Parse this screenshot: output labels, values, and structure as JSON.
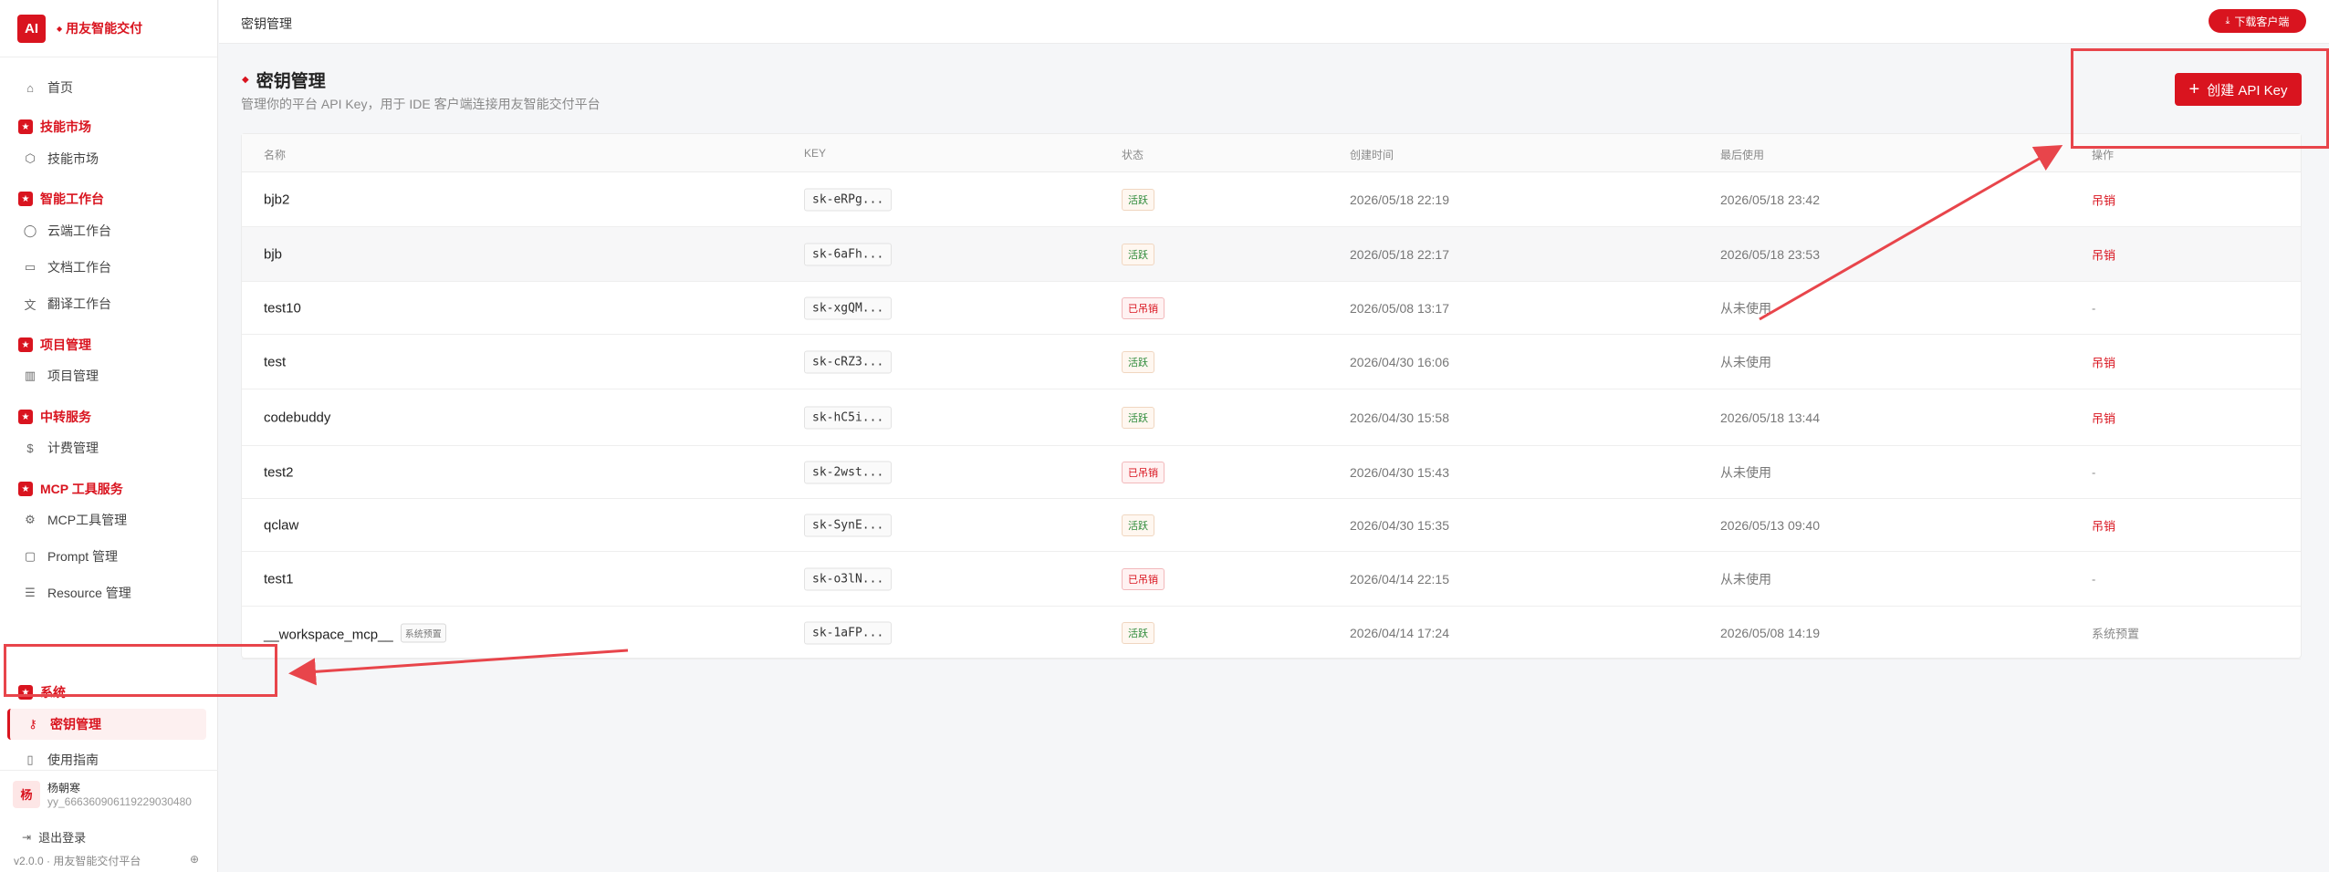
{
  "brand": {
    "logo_text": "AI",
    "name": "用友智能交付"
  },
  "sidebar": {
    "home": "首页",
    "sections": [
      {
        "title": "技能市场",
        "items": [
          "技能市场"
        ]
      },
      {
        "title": "智能工作台",
        "items": [
          "云端工作台",
          "文档工作台",
          "翻译工作台"
        ]
      },
      {
        "title": "项目管理",
        "items": [
          "项目管理"
        ]
      },
      {
        "title": "中转服务",
        "items": [
          "计费管理"
        ]
      },
      {
        "title": "MCP 工具服务",
        "items": [
          "MCP工具管理",
          "Prompt 管理",
          "Resource 管理"
        ]
      },
      {
        "title": "系统",
        "items": [
          "密钥管理",
          "使用指南"
        ]
      }
    ],
    "active_item": "密钥管理",
    "section_badge": "★"
  },
  "user": {
    "avatar": "杨",
    "name": "杨朝寒",
    "id": "yy_666360906119229030480"
  },
  "footer": {
    "logout": "退出登录",
    "version": "v2.0.0 · 用友智能交付平台"
  },
  "topbar": {
    "breadcrumb": "密钥管理",
    "download_label": "下载客户端"
  },
  "page": {
    "title": "密钥管理",
    "subtitle": "管理你的平台 API Key，用于 IDE 客户端连接用友智能交付平台",
    "create_label": "创建 API Key"
  },
  "table": {
    "columns": [
      "名称",
      "KEY",
      "状态",
      "创建时间",
      "最后使用",
      "操作"
    ],
    "rows": [
      {
        "name": "bjb2",
        "key": "sk-eRPg...",
        "status": "活跃",
        "status_type": "active",
        "created": "2026/05/18 22:19",
        "last_used": "2026/05/18 23:42",
        "action": "吊销"
      },
      {
        "name": "bjb",
        "key": "sk-6aFh...",
        "status": "活跃",
        "status_type": "active",
        "created": "2026/05/18 22:17",
        "last_used": "2026/05/18 23:53",
        "action": "吊销"
      },
      {
        "name": "test10",
        "key": "sk-xgQM...",
        "status": "已吊销",
        "status_type": "revoked",
        "created": "2026/05/08 13:17",
        "last_used": "从未使用",
        "action": "-"
      },
      {
        "name": "test",
        "key": "sk-cRZ3...",
        "status": "活跃",
        "status_type": "active",
        "created": "2026/04/30 16:06",
        "last_used": "从未使用",
        "action": "吊销"
      },
      {
        "name": "codebuddy",
        "key": "sk-hC5i...",
        "status": "活跃",
        "status_type": "active",
        "created": "2026/04/30 15:58",
        "last_used": "2026/05/18 13:44",
        "action": "吊销"
      },
      {
        "name": "test2",
        "key": "sk-2wst...",
        "status": "已吊销",
        "status_type": "revoked",
        "created": "2026/04/30 15:43",
        "last_used": "从未使用",
        "action": "-"
      },
      {
        "name": "qclaw",
        "key": "sk-SynE...",
        "status": "活跃",
        "status_type": "active",
        "created": "2026/04/30 15:35",
        "last_used": "2026/05/13 09:40",
        "action": "吊销"
      },
      {
        "name": "test1",
        "key": "sk-o3lN...",
        "status": "已吊销",
        "status_type": "revoked",
        "created": "2026/04/14 22:15",
        "last_used": "从未使用",
        "action": "-"
      },
      {
        "name": "__workspace_mcp__",
        "tag": "系统预置",
        "key": "sk-1aFP...",
        "status": "活跃",
        "status_type": "active",
        "created": "2026/04/14 17:24",
        "last_used": "2026/05/08 14:19",
        "action": "系统预置"
      }
    ]
  },
  "colors": {
    "brand": "#d9141f",
    "annotation": "#e8454b"
  },
  "icons": {
    "home": "home-icon",
    "market": "cube-icon",
    "cloud": "chat-icon",
    "doc": "document-icon",
    "translate": "translate-icon",
    "project": "columns-icon",
    "billing": "dollar-icon",
    "mcp": "gear-icon",
    "prompt": "message-icon",
    "resource": "database-icon",
    "key": "key-icon",
    "guide": "book-icon"
  }
}
